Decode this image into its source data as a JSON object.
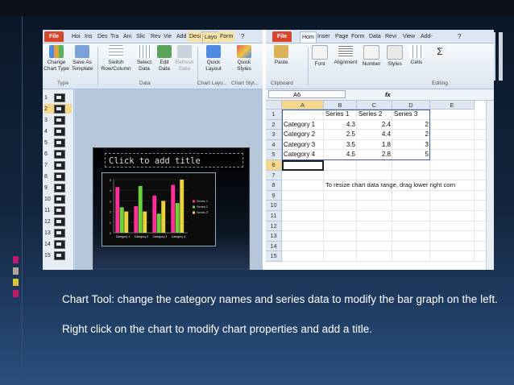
{
  "ppt": {
    "tabs": [
      "File",
      "Hoi",
      "Ins",
      "Des",
      "Tra",
      "Ani",
      "Slic",
      "Rev",
      "Vie",
      "Add",
      "Desi",
      "Layo",
      "Form"
    ],
    "ribbon": {
      "buttons": [
        {
          "label": "Change Chart Type"
        },
        {
          "label": "Save As Template"
        },
        {
          "label": "Switch Row/Column"
        },
        {
          "label": "Select Data"
        },
        {
          "label": "Edit Data"
        },
        {
          "label": "Refresh Data"
        },
        {
          "label": "Quick Layout"
        },
        {
          "label": "Quick Styles"
        }
      ],
      "groups": [
        "Type",
        "Data",
        "Chart Layo...",
        "Chart Styl..."
      ]
    },
    "thumbnails": [
      "1",
      "2",
      "3",
      "4",
      "5",
      "6",
      "7",
      "8",
      "9",
      "10",
      "11",
      "12",
      "13",
      "14",
      "15"
    ],
    "slide_title_placeholder": "Click to add title",
    "chart": {
      "categories": [
        "Category 1",
        "Category 2",
        "Category 3",
        "Category 4"
      ],
      "y_ticks": [
        "0",
        "1",
        "2",
        "3",
        "4",
        "5"
      ],
      "ylim": [
        0,
        5
      ]
    }
  },
  "excel": {
    "tabs": [
      "File",
      "Hom",
      "Inser",
      "Page",
      "Form",
      "Data",
      "Revi",
      "View",
      "Add-"
    ],
    "ribbon": {
      "buttons": [
        {
          "label": "Paste"
        },
        {
          "label": "Font"
        },
        {
          "label": "Alignment"
        },
        {
          "label": "Number"
        },
        {
          "label": "Styles"
        },
        {
          "label": "Cells"
        }
      ],
      "groups": [
        "Clipboard",
        "Editing"
      ]
    },
    "name_box": "A6",
    "fx_label": "fx",
    "columns": [
      "A",
      "B",
      "C",
      "D",
      "E"
    ],
    "rows": [
      "1",
      "2",
      "3",
      "4",
      "5",
      "6",
      "7",
      "8",
      "9",
      "10",
      "11",
      "12",
      "13",
      "14",
      "15"
    ],
    "header_row": [
      "",
      "Series 1",
      "Series 2",
      "Series 3"
    ],
    "data_rows": [
      [
        "Category 1",
        "4.3",
        "2.4",
        "2"
      ],
      [
        "Category 2",
        "2.5",
        "4.4",
        "2"
      ],
      [
        "Category 3",
        "3.5",
        "1.8",
        "3"
      ],
      [
        "Category 4",
        "4.5",
        "2.8",
        "5"
      ]
    ],
    "note": "To resize chart data range, drag lower right corn"
  },
  "chart_data": {
    "type": "bar",
    "categories": [
      "Category 1",
      "Category 2",
      "Category 3",
      "Category 4"
    ],
    "series": [
      {
        "name": "Series 1",
        "values": [
          4.3,
          2.5,
          3.5,
          4.5
        ],
        "color": "#ff2f9a"
      },
      {
        "name": "Series 2",
        "values": [
          2.4,
          4.4,
          1.8,
          2.8
        ],
        "color": "#6bd33a"
      },
      {
        "name": "Series 3",
        "values": [
          2,
          2,
          3,
          5
        ],
        "color": "#e9d23d"
      }
    ],
    "ylim": [
      0,
      5
    ],
    "legend": "right"
  },
  "caption": {
    "line1": "Chart Tool: change the category names and series data to modify the bar graph on the left.",
    "line2": "Right click on the chart to modify chart properties and add a title."
  },
  "colors": {
    "file_tab": "#d8472b",
    "slide_bg": "#0d1b2e",
    "accent_pink": "#b01874"
  }
}
